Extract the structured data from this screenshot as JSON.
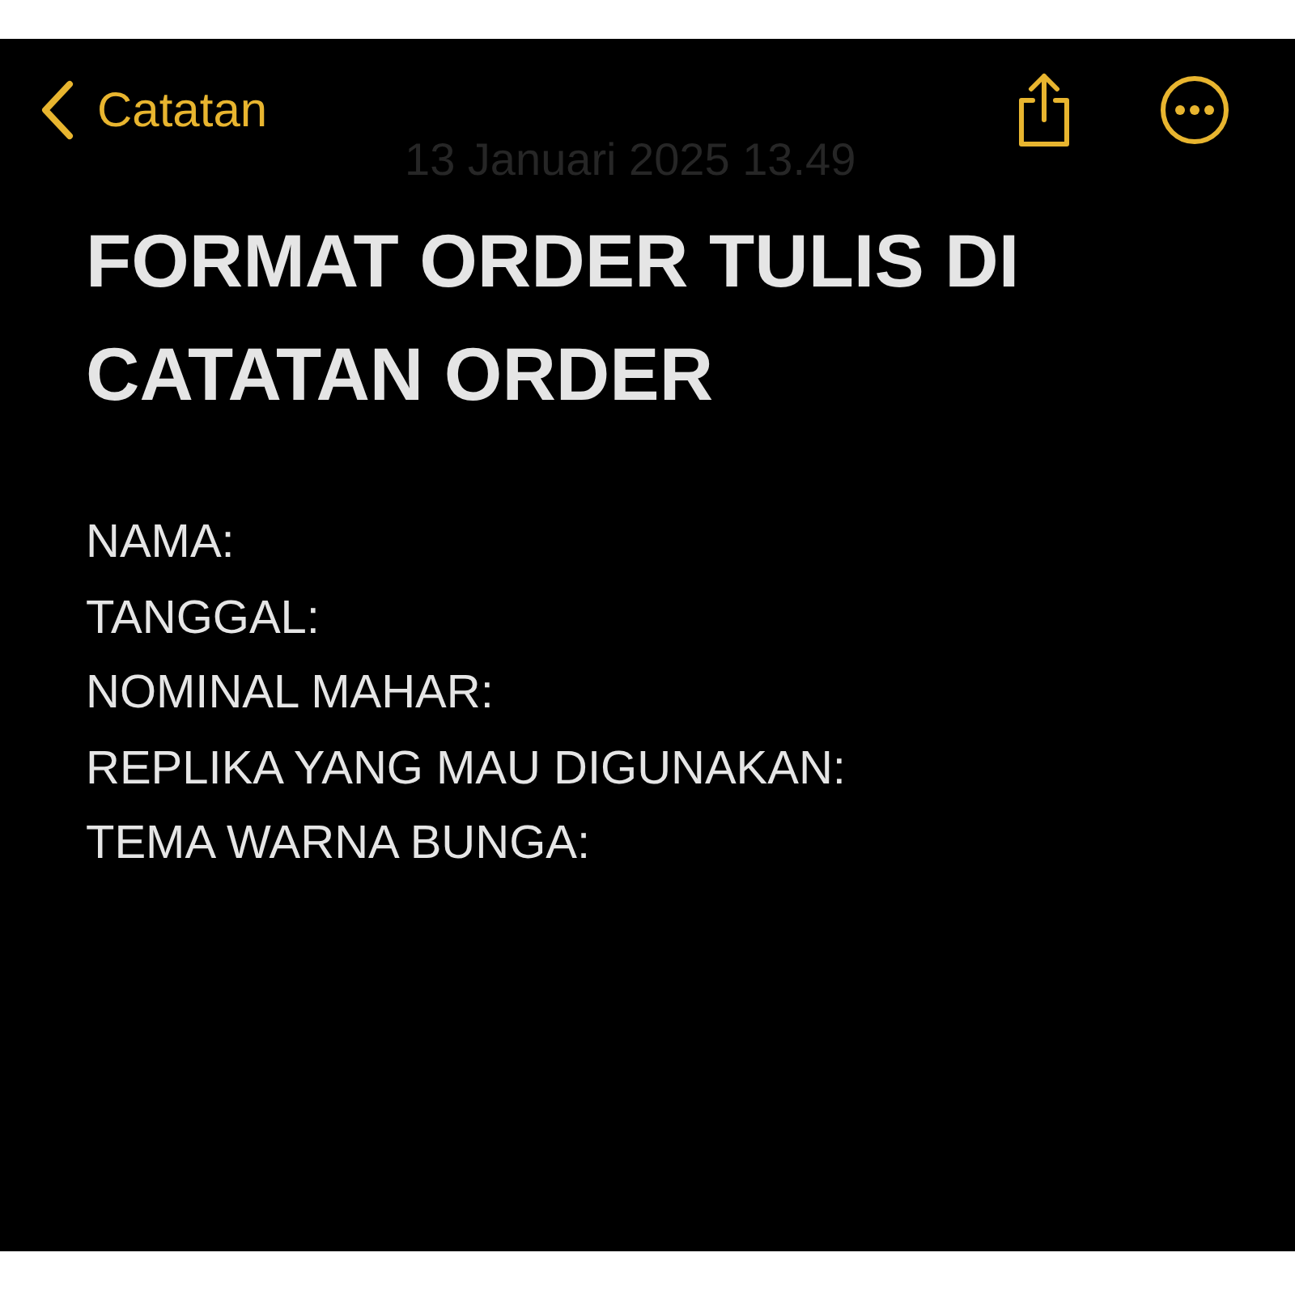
{
  "nav": {
    "back_label": "Catatan"
  },
  "date": "13 Januari 2025 13.49",
  "title": "FORMAT ORDER TULIS DI CATATAN ORDER",
  "lines": [
    "NAMA:",
    "TANGGAL:",
    "NOMINAL MAHAR:",
    "REPLIKA YANG MAU DIGUNAKAN:",
    "TEMA WARNA BUNGA:"
  ]
}
